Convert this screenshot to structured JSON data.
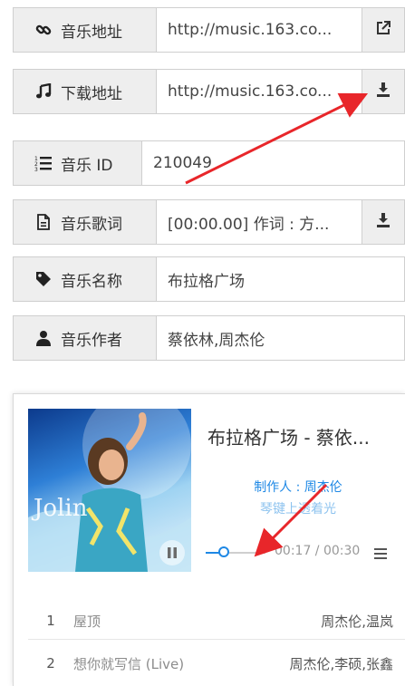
{
  "fields": [
    {
      "label": "音乐地址",
      "value": "http://music.163.co...",
      "icon": "link-icon",
      "action_icon": "external-link-icon"
    },
    {
      "label": "下载地址",
      "value": "http://music.163.co...",
      "icon": "music-note-icon",
      "action_icon": "download-icon"
    },
    {
      "label": "音乐 ID",
      "value": "210049",
      "icon": "list-ordered-icon"
    },
    {
      "label": "音乐歌词",
      "value": "[00:00.00] 作词 : 方...",
      "icon": "file-text-icon",
      "action_icon": "download-icon"
    },
    {
      "label": "音乐名称",
      "value": "布拉格广场",
      "icon": "tag-icon"
    },
    {
      "label": "音乐作者",
      "value": "蔡依林,周杰伦",
      "icon": "user-icon"
    }
  ],
  "player": {
    "title": "布拉格广场 - 蔡依...",
    "lyric_current": "制作人 : 周杰伦",
    "lyric_next": "琴键上透着光",
    "time": "00:17 / 00:30",
    "progress": 0.3,
    "playlist": [
      {
        "index": "1",
        "name": "屋顶",
        "artist": "周杰伦,温岚"
      },
      {
        "index": "2",
        "name": "想你就写信 (Live)",
        "artist": "周杰伦,李硕,张鑫"
      }
    ]
  },
  "colors": {
    "accent": "#1e88e5",
    "arrow": "#e8262a",
    "addon_bg": "#eeeeee"
  }
}
